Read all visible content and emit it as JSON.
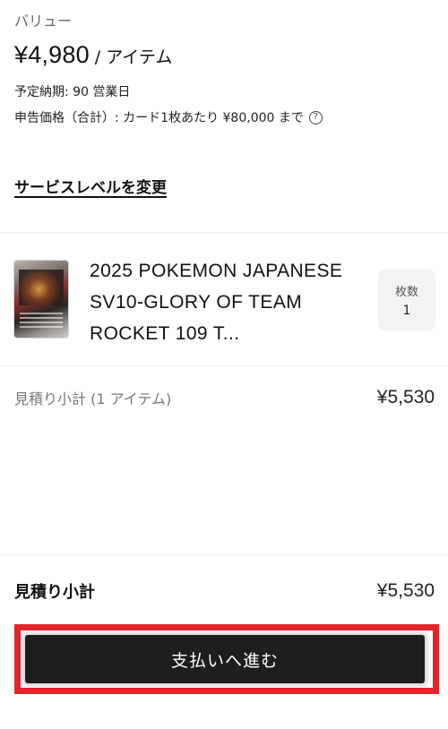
{
  "service_level": {
    "label": "バリュー",
    "price": "¥4,980",
    "price_unit": "/ アイテム",
    "delivery": "予定納期: 90 営業日",
    "declared_value": "申告価格（合計）: カード1枚あたり ¥80,000 まで",
    "help_icon": "question-circle-icon",
    "change_link": "サービスレベルを変更"
  },
  "item": {
    "thumbnail_icon": "trading-card-image",
    "title": "2025 POKEMON JAPANESE SV10-GLORY OF TEAM ROCKET 109 T...",
    "qty_label": "枚数",
    "qty_value": "1"
  },
  "subtotal_items": {
    "label": "見積り小計 (1 アイテム)",
    "value": "¥5,530"
  },
  "subtotal": {
    "label": "見積り小計",
    "value": "¥5,530"
  },
  "checkout": {
    "label": "支払いへ進む"
  },
  "colors": {
    "button_bg": "#1e1e1e",
    "highlight": "#e2262b",
    "muted_text": "#777777"
  }
}
